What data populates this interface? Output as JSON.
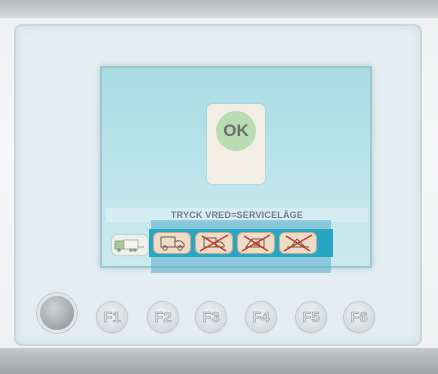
{
  "screen": {
    "ok_label": "OK",
    "message": "TRYCK VRED=SERVICELÄGE"
  },
  "icons": {
    "mode": "truck-trailer-icon",
    "buttons": [
      {
        "name": "truck-icon",
        "disabled": false
      },
      {
        "name": "truck-crossed-icon",
        "disabled": true
      },
      {
        "name": "tipper-crossed-icon",
        "disabled": true
      },
      {
        "name": "lift-crossed-icon",
        "disabled": true
      }
    ]
  },
  "function_keys": [
    "F1",
    "F2",
    "F3",
    "F4",
    "F5",
    "F6"
  ],
  "colors": {
    "screen_bg": "#bfe6ec",
    "strip": "#27a6c6",
    "ok_circle": "#b9dcb2",
    "icon_button": "#eedcc6",
    "cross": "#c0392b"
  }
}
